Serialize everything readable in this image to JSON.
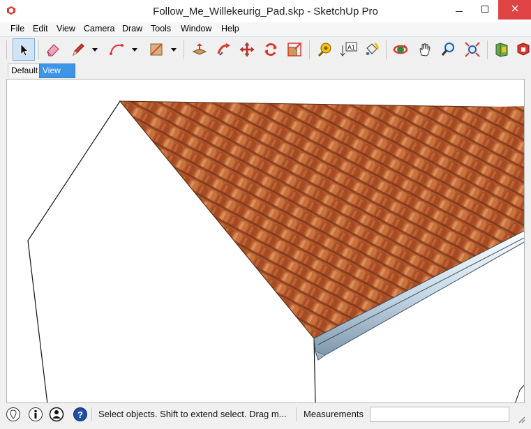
{
  "window": {
    "title": "Follow_Me_Willekeurig_Pad.skp - SketchUp Pro",
    "controls": [
      "minimize",
      "maximize",
      "close"
    ]
  },
  "menu": [
    "File",
    "Edit",
    "View",
    "Camera",
    "Draw",
    "Tools",
    "Window",
    "Help"
  ],
  "toolbar": {
    "tools": [
      {
        "name": "select-icon",
        "active": true
      },
      {
        "name": "eraser-icon"
      },
      {
        "name": "line-pencil-icon"
      },
      {
        "name": "arc-icon"
      },
      {
        "name": "rectangle-icon"
      },
      {
        "name": "push-pull-icon"
      },
      {
        "name": "follow-me-icon"
      },
      {
        "name": "move-icon"
      },
      {
        "name": "rotate-icon"
      },
      {
        "name": "scale-icon"
      },
      {
        "name": "tape-measure-icon"
      },
      {
        "name": "text-icon"
      },
      {
        "name": "paint-bucket-icon"
      },
      {
        "name": "orbit-icon"
      },
      {
        "name": "pan-icon"
      },
      {
        "name": "zoom-icon"
      },
      {
        "name": "zoom-extents-icon"
      },
      {
        "name": "3d-warehouse-icon"
      },
      {
        "name": "extension-warehouse-icon"
      }
    ],
    "text_tool_label": "A1"
  },
  "scenes": {
    "tabs": [
      "Default",
      "View"
    ],
    "active": "View"
  },
  "status": {
    "hint": "Select objects. Shift to extend select. Drag m...",
    "measurements_label": "Measurements",
    "measurements_value": "",
    "icons": [
      "geo-location-icon",
      "credits-icon",
      "user-account-icon",
      "instructor-help-icon"
    ]
  },
  "colors": {
    "roof_tile": "#b5532a",
    "gutter": "#c7d9e6",
    "scene_tab_active": "#3d95e6",
    "close_button": "#e04343"
  }
}
